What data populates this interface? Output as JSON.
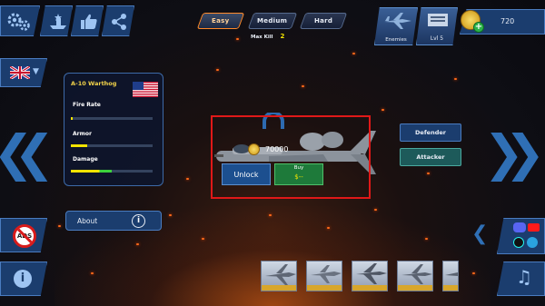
{
  "difficulty": {
    "easy": "Easy",
    "medium": "Medium",
    "hard": "Hard",
    "selected": "Easy",
    "max_kill_label": "Max Kill",
    "max_kill_value": "2"
  },
  "top_right": {
    "enemies_label": "Enemies",
    "level_label": "Lvl 5",
    "coins": "720"
  },
  "aircraft": {
    "name": "A-10 Warthog",
    "stats": [
      {
        "label": "Fire Rate",
        "value": 0.02
      },
      {
        "label": "Armor",
        "value": 0.2
      },
      {
        "label": "Damage",
        "value": 0.5
      }
    ],
    "price": "70000",
    "unlock_label": "Unlock",
    "buy_label": "Buy",
    "buy_price": "$--"
  },
  "roles": {
    "defender": "Defender",
    "attacker": "Attacker"
  },
  "about_label": "About",
  "no_ads_label": "ADS",
  "icons": [
    "settings-icon",
    "ship-icon",
    "like-icon",
    "share-icon",
    "uk-flag-icon",
    "us-flag-icon",
    "info-icon",
    "music-icon",
    "discord-icon",
    "youtube-icon",
    "tiktok-icon",
    "telegram-icon",
    "coin-icon",
    "add-icon",
    "lock-icon"
  ],
  "colors": {
    "accent_orange": "#ff8a2a",
    "panel_border": "#3d6aa8",
    "bar_yellow": "#f2e300",
    "bar_green": "#3cd23c",
    "buy_green": "#1e7a3a",
    "unlock_blue": "#1c4f8f",
    "highlight_red": "#e01818"
  }
}
